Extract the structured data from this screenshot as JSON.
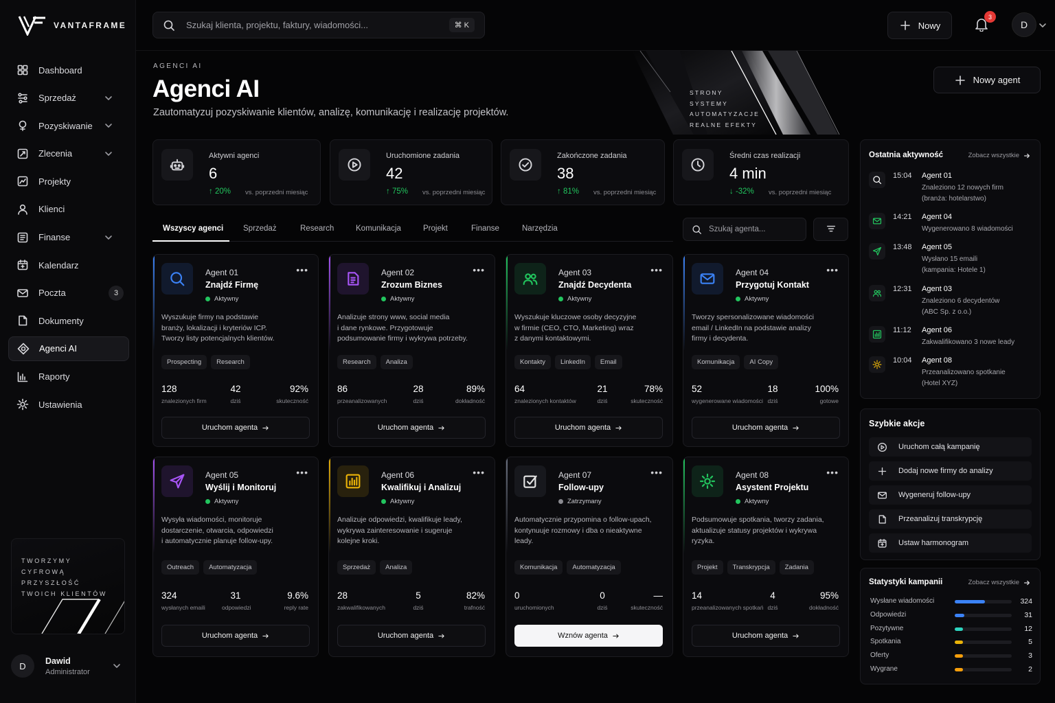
{
  "brand": {
    "name": "VANTAFRAME"
  },
  "search": {
    "placeholder": "Szukaj klienta, projektu, faktury, wiadomości...",
    "shortcut": "⌘ K"
  },
  "topbar": {
    "new_label": "Nowy",
    "notifications": "3",
    "avatar": "D"
  },
  "sidebar": {
    "items": [
      {
        "label": "Dashboard",
        "icon": "grid-icon",
        "chevron": false
      },
      {
        "label": "Sprzedaż",
        "icon": "sales-icon",
        "chevron": true
      },
      {
        "label": "Pozyskiwanie",
        "icon": "acquire-icon",
        "chevron": true
      },
      {
        "label": "Zlecenia",
        "icon": "orders-icon",
        "chevron": true
      },
      {
        "label": "Projekty",
        "icon": "projects-icon",
        "chevron": false
      },
      {
        "label": "Klienci",
        "icon": "clients-icon",
        "chevron": false
      },
      {
        "label": "Finanse",
        "icon": "finance-icon",
        "chevron": true
      },
      {
        "label": "Kalendarz",
        "icon": "calendar-icon",
        "chevron": false
      },
      {
        "label": "Poczta",
        "icon": "mail-icon",
        "chevron": false,
        "badge": "3"
      },
      {
        "label": "Dokumenty",
        "icon": "document-icon",
        "chevron": false
      },
      {
        "label": "Agenci AI",
        "icon": "ai-icon",
        "chevron": false,
        "active": true
      },
      {
        "label": "Raporty",
        "icon": "reports-icon",
        "chevron": false
      },
      {
        "label": "Ustawienia",
        "icon": "settings-icon",
        "chevron": false
      }
    ],
    "promo": [
      "TWORZYMY",
      "CYFROWĄ PRZYSZŁOŚĆ",
      "TWOICH KLIENTÓW"
    ],
    "user": {
      "initial": "D",
      "name": "Dawid",
      "role": "Administrator"
    }
  },
  "header": {
    "eyebrow": "AGENCI AI",
    "title": "Agenci AI",
    "subtitle": "Zautomatyzuj pozyskiwanie klientów, analizę, komunikację i realizację projektów.",
    "hero_words": [
      "STRONY",
      "SYSTEMY",
      "AUTOMATYZACJE",
      "REALNE EFEKTY"
    ],
    "new_agent_label": "Nowy agent"
  },
  "stats": [
    {
      "label": "Aktywni agenci",
      "value": "6",
      "delta": "20%",
      "direction": "up",
      "vs": "vs. poprzedni miesiąc",
      "icon": "robot-icon"
    },
    {
      "label": "Uruchomione zadania",
      "value": "42",
      "delta": "75%",
      "direction": "up",
      "vs": "vs. poprzedni miesiąc",
      "icon": "play-icon"
    },
    {
      "label": "Zakończone zadania",
      "value": "38",
      "delta": "81%",
      "direction": "up",
      "vs": "vs. poprzedni miesiąc",
      "icon": "check-circle-icon"
    },
    {
      "label": "Średni czas realizacji",
      "value": "4 min",
      "delta": "-32%",
      "direction": "down",
      "vs": "vs. poprzedni miesiąc",
      "icon": "clock-icon"
    }
  ],
  "tabs": [
    "Wszyscy agenci",
    "Sprzedaż",
    "Research",
    "Komunikacja",
    "Projekt",
    "Finanse",
    "Narzędzia"
  ],
  "agent_search": {
    "placeholder": "Szukaj agenta..."
  },
  "agents": [
    {
      "num": "Agent 01",
      "title": "Znajdź Firmę",
      "status": "Aktywny",
      "accent": "#3b82f6",
      "icon": "search-icon",
      "desc": [
        "Wyszukuje firmy na podstawie",
        "branży, lokalizacji i kryteriów ICP.",
        "Tworzy listy potencjalnych klientów."
      ],
      "tags": [
        "Prospecting",
        "Research"
      ],
      "metrics": [
        {
          "v": "128",
          "l": "znalezionych firm"
        },
        {
          "v": "42",
          "l": "dziś"
        },
        {
          "v": "92%",
          "l": "skuteczność"
        }
      ],
      "button": "Uruchom agenta"
    },
    {
      "num": "Agent 02",
      "title": "Zrozum Biznes",
      "status": "Aktywny",
      "accent": "#a855f7",
      "icon": "document-analysis-icon",
      "desc": [
        "Analizuje strony www, social media",
        "i dane rynkowe. Przygotowuje",
        "podsumowanie firmy i wykrywa potrzeby."
      ],
      "tags": [
        "Research",
        "Analiza"
      ],
      "metrics": [
        {
          "v": "86",
          "l": "przeanalizowanych"
        },
        {
          "v": "28",
          "l": "dziś"
        },
        {
          "v": "89%",
          "l": "dokładność"
        }
      ],
      "button": "Uruchom agenta"
    },
    {
      "num": "Agent 03",
      "title": "Znajdź Decydenta",
      "status": "Aktywny",
      "accent": "#22c55e",
      "icon": "users-icon",
      "desc": [
        "Wyszukuje kluczowe osoby decyzyjne",
        "w firmie (CEO, CTO, Marketing) wraz",
        "z danymi kontaktowymi."
      ],
      "tags": [
        "Kontakty",
        "LinkedIn",
        "Email"
      ],
      "metrics": [
        {
          "v": "64",
          "l": "znalezionych kontaktów"
        },
        {
          "v": "21",
          "l": "dziś"
        },
        {
          "v": "78%",
          "l": "skuteczność"
        }
      ],
      "button": "Uruchom agenta"
    },
    {
      "num": "Agent 04",
      "title": "Przygotuj Kontakt",
      "status": "Aktywny",
      "accent": "#3b82f6",
      "icon": "mail-icon",
      "desc": [
        "Tworzy spersonalizowane wiadomości",
        "email / LinkedIn na podstawie analizy",
        "firmy i decydenta."
      ],
      "tags": [
        "Komunikacja",
        "AI Copy"
      ],
      "metrics": [
        {
          "v": "52",
          "l": "wygenerowane wiadomości"
        },
        {
          "v": "18",
          "l": "dziś"
        },
        {
          "v": "100%",
          "l": "gotowe"
        }
      ],
      "button": "Uruchom agenta"
    },
    {
      "num": "Agent 05",
      "title": "Wyślij i Monitoruj",
      "status": "Aktywny",
      "accent": "#a855f7",
      "icon": "send-icon",
      "desc": [
        "Wysyła wiadomości, monitoruje",
        "dostarczenie, otwarcia, odpowiedzi",
        "i automatycznie planuje follow-upy."
      ],
      "tags": [
        "Outreach",
        "Automatyzacja"
      ],
      "metrics": [
        {
          "v": "324",
          "l": "wysłanych emaili"
        },
        {
          "v": "31",
          "l": "odpowiedzi"
        },
        {
          "v": "9.6%",
          "l": "reply rate"
        }
      ],
      "button": "Uruchom agenta"
    },
    {
      "num": "Agent 06",
      "title": "Kwalifikuj i Analizuj",
      "status": "Aktywny",
      "accent": "#eab308",
      "icon": "bar-chart-icon",
      "desc": [
        "Analizuje odpowiedzi, kwalifikuje leady,",
        "wykrywa zainteresowanie i sugeruje",
        "kolejne kroki."
      ],
      "tags": [
        "Sprzedaż",
        "Analiza"
      ],
      "metrics": [
        {
          "v": "28",
          "l": "zakwalifikowanych"
        },
        {
          "v": "5",
          "l": "dziś"
        },
        {
          "v": "82%",
          "l": "trafność"
        }
      ],
      "button": "Uruchom agenta"
    },
    {
      "num": "Agent 07",
      "title": "Follow-upy",
      "status": "Zatrzymany",
      "accent": "#6b7280",
      "icon": "checkbox-edit-icon",
      "desc": [
        "Automatycznie przypomina o follow-upach,",
        "kontynuuje rozmowy i dba o nieaktywne",
        "leady."
      ],
      "tags": [
        "Komunikacja",
        "Automatyzacja"
      ],
      "metrics": [
        {
          "v": "0",
          "l": "uruchomionych"
        },
        {
          "v": "0",
          "l": "dziś"
        },
        {
          "v": "—",
          "l": "skuteczność"
        }
      ],
      "button": "Wznów agenta",
      "primary": true
    },
    {
      "num": "Agent 08",
      "title": "Asystent Projektu",
      "status": "Aktywny",
      "accent": "#22c55e",
      "icon": "gear-icon",
      "desc": [
        "Podsumowuje spotkania, tworzy zadania,",
        "aktualizuje statusy projektów i wykrywa",
        "ryzyka."
      ],
      "tags": [
        "Projekt",
        "Transkrypcja",
        "Zadania"
      ],
      "metrics": [
        {
          "v": "14",
          "l": "przeanalizowanych spotkań"
        },
        {
          "v": "4",
          "l": "dziś"
        },
        {
          "v": "95%",
          "l": "dokładność"
        }
      ],
      "button": "Uruchom agenta"
    }
  ],
  "activity": {
    "title": "Ostatnia aktywność",
    "link": "Zobacz wszystkie",
    "items": [
      {
        "time": "15:04",
        "agent": "Agent 01",
        "text": [
          "Znaleziono 12 nowych firm",
          "(branża: hotelarstwo)"
        ],
        "icon": "search-icon",
        "color": "#ffffff"
      },
      {
        "time": "14:21",
        "agent": "Agent 04",
        "text": [
          "Wygenerowano 8 wiadomości"
        ],
        "icon": "mail-icon",
        "color": "#22c55e"
      },
      {
        "time": "13:48",
        "agent": "Agent 05",
        "text": [
          "Wysłano 15 emaili",
          "(kampania: Hotele 1)"
        ],
        "icon": "send-icon",
        "color": "#22c55e"
      },
      {
        "time": "12:31",
        "agent": "Agent 03",
        "text": [
          "Znaleziono 6 decydentów",
          "(ABC Sp. z o.o.)"
        ],
        "icon": "users-icon",
        "color": "#22c55e"
      },
      {
        "time": "11:12",
        "agent": "Agent 06",
        "text": [
          "Zakwalifikowano 3 nowe leady"
        ],
        "icon": "bar-chart-icon",
        "color": "#22c55e"
      },
      {
        "time": "10:04",
        "agent": "Agent 08",
        "text": [
          "Przeanalizowano spotkanie",
          "(Hotel XYZ)"
        ],
        "icon": "gear-icon",
        "color": "#eab308"
      }
    ]
  },
  "quick_actions": {
    "title": "Szybkie akcje",
    "items": [
      {
        "label": "Uruchom całą kampanię",
        "icon": "play-icon"
      },
      {
        "label": "Dodaj nowe firmy do analizy",
        "icon": "plus-icon"
      },
      {
        "label": "Wygeneruj follow-upy",
        "icon": "mail-icon"
      },
      {
        "label": "Przeanalizuj transkrypcję",
        "icon": "document-icon"
      },
      {
        "label": "Ustaw harmonogram",
        "icon": "calendar-icon"
      }
    ]
  },
  "campaign_stats": {
    "title": "Statystyki kampanii",
    "link": "Zobacz wszystkie",
    "max": 324,
    "rows": [
      {
        "label": "Wysłane wiadomości",
        "value": 324,
        "color": "#3b82f6"
      },
      {
        "label": "Odpowiedzi",
        "value": 31,
        "color": "#3b82f6"
      },
      {
        "label": "Pozytywne",
        "value": 12,
        "color": "#2dd4bf"
      },
      {
        "label": "Spotkania",
        "value": 5,
        "color": "#eab308"
      },
      {
        "label": "Oferty",
        "value": 3,
        "color": "#f59e0b"
      },
      {
        "label": "Wygrane",
        "value": 2,
        "color": "#f59e0b"
      }
    ]
  }
}
